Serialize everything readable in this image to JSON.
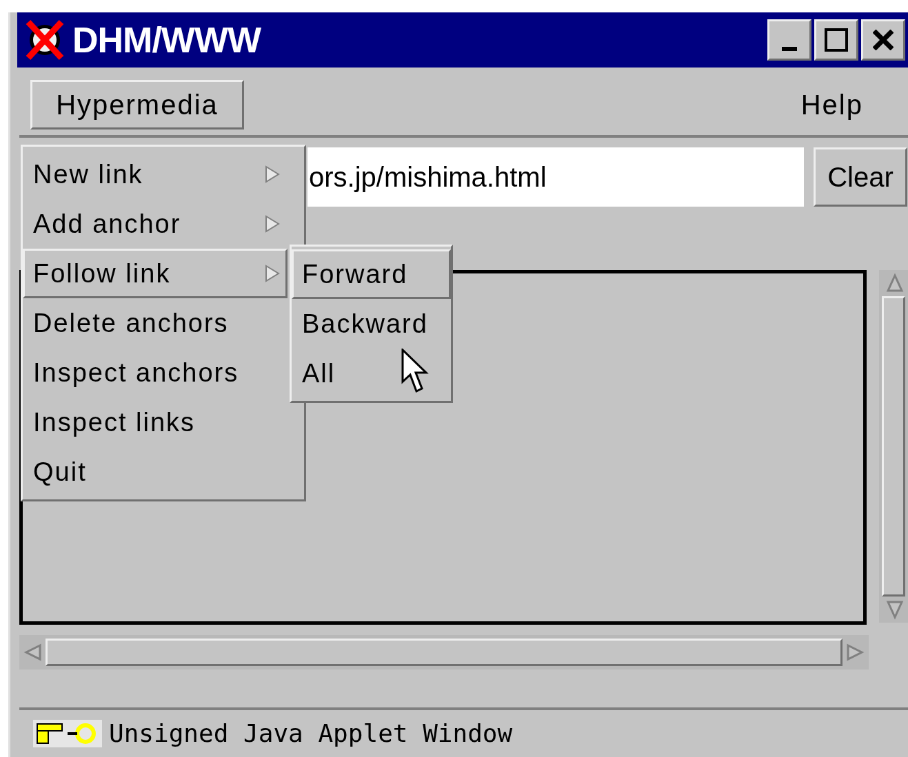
{
  "window": {
    "title": "DHM/WWW"
  },
  "menubar": [
    {
      "label": "Hypermedia",
      "selected": true
    },
    {
      "label": "Help",
      "selected": false
    }
  ],
  "url_field": {
    "value": "ors.jp/mishima.html"
  },
  "clear_button": "Clear",
  "menu": {
    "items": [
      {
        "label": "New link",
        "submenu": true,
        "selected": false
      },
      {
        "label": "Add anchor",
        "submenu": true,
        "selected": false
      },
      {
        "label": "Follow link",
        "submenu": true,
        "selected": true
      },
      {
        "label": "Delete anchors",
        "submenu": false,
        "selected": false
      },
      {
        "label": "Inspect anchors",
        "submenu": false,
        "selected": false
      },
      {
        "label": "Inspect links",
        "submenu": false,
        "selected": false
      },
      {
        "label": "Quit",
        "submenu": false,
        "selected": false
      }
    ]
  },
  "submenu": {
    "items": [
      {
        "label": "Forward",
        "selected": true
      },
      {
        "label": "Backward",
        "selected": false
      },
      {
        "label": "All",
        "selected": false
      }
    ]
  },
  "status_bar": "Unsigned Java Applet Window"
}
